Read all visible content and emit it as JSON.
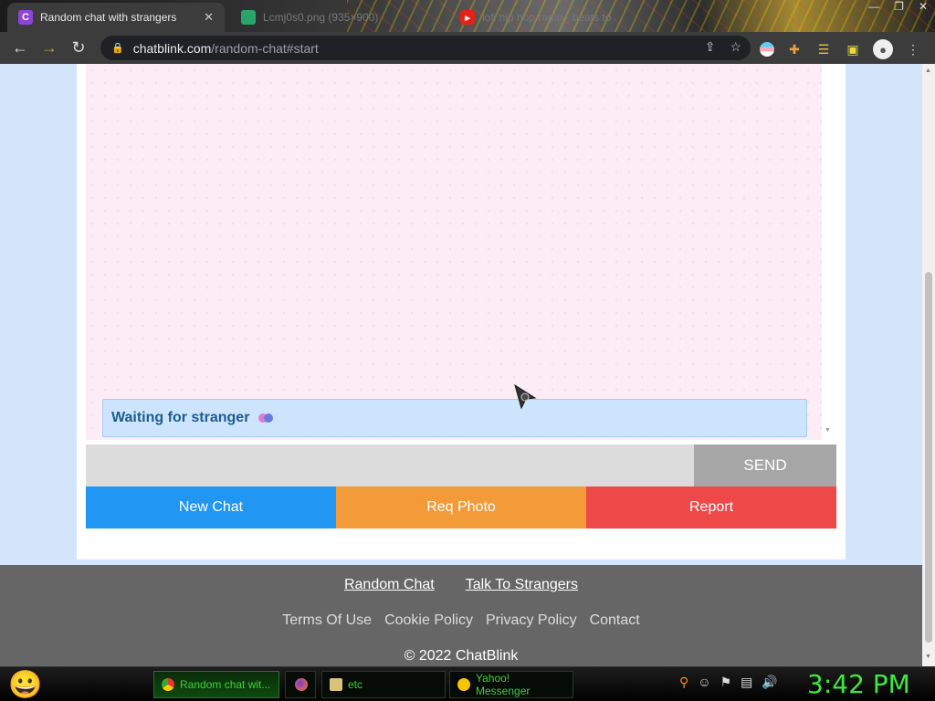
{
  "browser": {
    "tabs": [
      {
        "label": "Random chat with strangers",
        "favicon": "C",
        "active": true
      },
      {
        "label": "Lcmj0s0.png (935×900)",
        "active": false
      },
      {
        "label": "lofi hip hop radio - beats to",
        "active": false
      }
    ],
    "close_glyph": "✕",
    "url_host": "chatblink.com",
    "url_path": "/random-chat#start"
  },
  "chat": {
    "status_text": "Waiting for stranger",
    "message_placeholder": "",
    "send_label": "SEND",
    "actions": {
      "new_chat": "New Chat",
      "req_photo": "Req Photo",
      "report": "Report"
    }
  },
  "footer": {
    "links_primary": [
      "Random Chat",
      "Talk To Strangers"
    ],
    "links_secondary": [
      "Terms Of Use",
      "Cookie Policy",
      "Privacy Policy",
      "Contact"
    ],
    "copyright": "© 2022 ChatBlink"
  },
  "taskbar": {
    "items": [
      {
        "label": "Random chat wit..."
      },
      {
        "label": ""
      },
      {
        "label": "etc"
      },
      {
        "label": "Yahoo! Messenger"
      }
    ],
    "clock": "3:42 PM"
  },
  "colors": {
    "new_chat": "#2196f3",
    "req_photo": "#f29b38",
    "report": "#ee4848",
    "status_bg": "#cce5fc",
    "status_text": "#1f5b8e",
    "chat_bg": "#fcecf5",
    "footer_bg": "#666666",
    "clock": "#3fe83f"
  }
}
